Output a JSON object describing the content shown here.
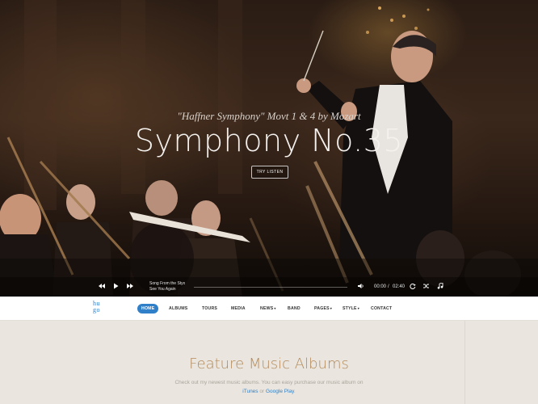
{
  "hero": {
    "subtitle": "\"Haffner Symphony\" Movt 1 & 4 by Mozart",
    "title": "Symphony No.35",
    "button": "TRY LISTEN"
  },
  "player": {
    "song_title": "Song From the Styx",
    "song_sub": "See You Again",
    "current_time": "00:00",
    "separator": "/",
    "duration": "02:40",
    "progress": 0,
    "icons": [
      "rewind-icon",
      "play-icon",
      "fast-forward-icon",
      "volume-icon",
      "repeat-icon",
      "shuffle-icon",
      "playlist-icon"
    ]
  },
  "nav": {
    "logo_top": "hu",
    "logo_bottom": "go",
    "items": [
      {
        "label": "HOME",
        "active": true
      },
      {
        "label": "ALBUMS"
      },
      {
        "label": "TOURS"
      },
      {
        "label": "MEDIA"
      },
      {
        "label": "NEWS",
        "dropdown": true
      },
      {
        "label": "BAND"
      },
      {
        "label": "PAGES",
        "dropdown": true
      },
      {
        "label": "STYLE",
        "dropdown": true
      },
      {
        "label": "CONTACT"
      }
    ],
    "caret": "▾"
  },
  "feature": {
    "title": "Feature Music Albums",
    "desc": "Check out my newest music albums. You can easy purchase our music album on",
    "link1": "iTunes",
    "or": "or",
    "link2": "Google Play",
    "end": "."
  },
  "colors": {
    "accent": "#2f80c9",
    "title_gold": "#b38a5b",
    "page_bg": "#eae6df"
  }
}
